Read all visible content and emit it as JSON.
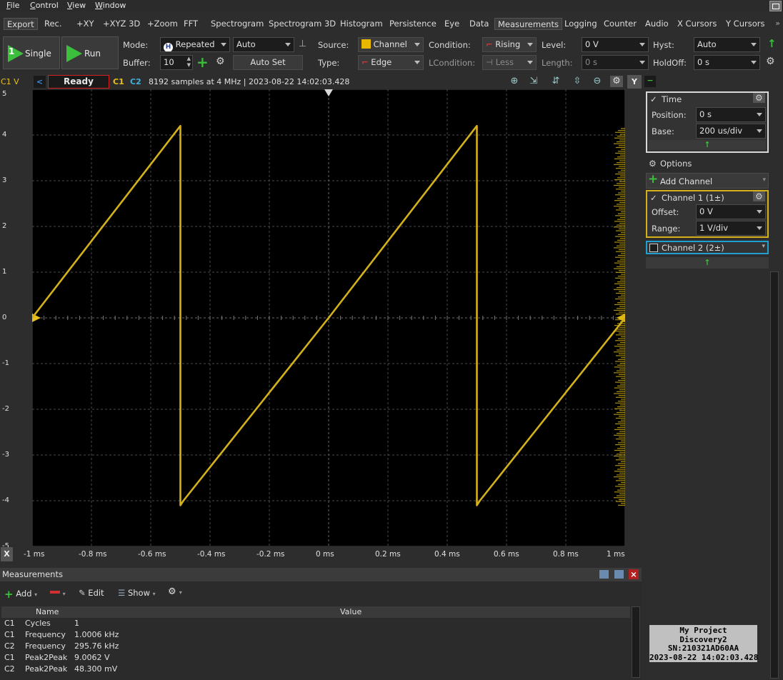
{
  "menu": [
    "File",
    "Control",
    "View",
    "Window"
  ],
  "tabs": [
    "Export",
    "Rec.",
    "+XY",
    "+XYZ 3D",
    "+Zoom",
    "FFT",
    "Spectrogram",
    "Spectrogram 3D",
    "Histogram",
    "Persistence",
    "Eye",
    "Data",
    "Measurements",
    "Logging",
    "Counter",
    "Audio",
    "X Cursors",
    "Y Cursors"
  ],
  "tab_more": "»",
  "controls": {
    "single": "Single",
    "single_num": "1",
    "run": "Run",
    "mode_label": "Mode:",
    "mode_value": "Repeated",
    "mode_auto": "Auto",
    "buffer_label": "Buffer:",
    "buffer_value": "10",
    "auto_set": "Auto Set",
    "source_label": "Source:",
    "source_value": "Channel",
    "type_label": "Type:",
    "type_value": "Edge",
    "condition_label": "Condition:",
    "condition_value": "Rising",
    "lcondition_label": "LCondition:",
    "lcondition_value": "Less",
    "level_label": "Level:",
    "level_value": "0 V",
    "length_label": "Length:",
    "length_value": "0 s",
    "hyst_label": "Hyst:",
    "hyst_value": "Auto",
    "holdoff_label": "HoldOff:",
    "holdoff_value": "0 s"
  },
  "plot_header": {
    "channel_unit": "C1 V",
    "status": "Ready",
    "c1": "C1",
    "c2": "C2",
    "info": "8192 samples at 4 MHz | 2023-08-22 14:02:03.428",
    "y_button": "Y"
  },
  "chart_data": {
    "type": "line",
    "xlabel": "",
    "ylabel": "C1 V",
    "xlim": [
      -1,
      1
    ],
    "ylim": [
      -5,
      5
    ],
    "x_ticks": [
      "-1 ms",
      "-0.8 ms",
      "-0.6 ms",
      "-0.4 ms",
      "-0.2 ms",
      "0 ms",
      "0.2 ms",
      "0.4 ms",
      "0.6 ms",
      "0.8 ms",
      "1 ms"
    ],
    "y_ticks": [
      "5",
      "4",
      "3",
      "2",
      "1",
      "0",
      "-1",
      "-2",
      "-3",
      "-4",
      "-5"
    ],
    "x_button": "X",
    "series": [
      {
        "name": "C1",
        "color": "#d4b01a",
        "x": [
          -1.0,
          -0.5,
          -0.5,
          -0.49,
          0.0,
          0.5,
          0.5,
          0.51,
          1.0
        ],
        "y": [
          0.0,
          4.2,
          -4.1,
          -4.0,
          0.0,
          4.2,
          -4.1,
          -4.0,
          0.0
        ]
      }
    ]
  },
  "right_panel": {
    "time_title": "Time",
    "position_label": "Position:",
    "position_value": "0 s",
    "base_label": "Base:",
    "base_value": "200 us/div",
    "options": "Options",
    "add_channel": "Add Channel",
    "ch1_title": "Channel 1 (1±)",
    "offset_label": "Offset:",
    "offset_value": "0 V",
    "range_label": "Range:",
    "range_value": "1 V/div",
    "ch2_title": "Channel 2 (2±)",
    "ch1_color": "#d4b01a",
    "ch2_color": "#1fa0d0"
  },
  "measurements": {
    "title": "Measurements",
    "add": "Add",
    "edit": "Edit",
    "show": "Show",
    "col_name": "Name",
    "col_value": "Value",
    "rows": [
      {
        "ch": "C1",
        "name": "Cycles",
        "value": "1"
      },
      {
        "ch": "C1",
        "name": "Frequency",
        "value": "1.0006 kHz"
      },
      {
        "ch": "C2",
        "name": "Frequency",
        "value": "295.76 kHz"
      },
      {
        "ch": "C1",
        "name": "Peak2Peak",
        "value": "9.0062 V"
      },
      {
        "ch": "C2",
        "name": "Peak2Peak",
        "value": "48.300 mV"
      }
    ]
  },
  "project": {
    "line1": "My Project",
    "line2": "Discovery2",
    "line3": "SN:210321AD60AA",
    "line4": "2023-08-22 14:02:03.428"
  }
}
